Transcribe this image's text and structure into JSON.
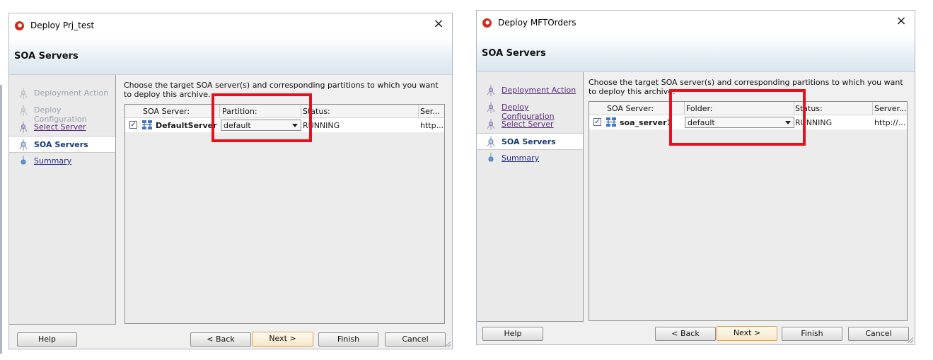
{
  "dialogs": [
    {
      "title": "Deploy Prj_test",
      "header": "SOA Servers",
      "nav": [
        {
          "label": "Deployment Action",
          "state": "disabled"
        },
        {
          "label": "Deploy Configuration",
          "state": "disabled"
        },
        {
          "label": "Select Server",
          "state": "link"
        },
        {
          "label": "SOA Servers",
          "state": "current"
        },
        {
          "label": "Summary",
          "state": "link"
        }
      ],
      "instructions": "Choose the target SOA server(s) and corresponding partitions to which you want to deploy this archive.",
      "columns": [
        "SOA Server:",
        "Partition:",
        "Status:",
        "Ser..."
      ],
      "row": {
        "checked": true,
        "server": "DefaultServer",
        "partition": "default",
        "status": "RUNNING",
        "server_url": "http..."
      },
      "buttons": {
        "help": "Help",
        "back": "< Back",
        "next": "Next >",
        "finish": "Finish",
        "cancel": "Cancel"
      }
    },
    {
      "title": "Deploy MFTOrders",
      "header": "SOA Servers",
      "nav": [
        {
          "label": "Deployment Action",
          "state": "link"
        },
        {
          "label": "Deploy Configuration",
          "state": "link"
        },
        {
          "label": "Select Server",
          "state": "link"
        },
        {
          "label": "SOA Servers",
          "state": "current"
        },
        {
          "label": "Summary",
          "state": "link"
        }
      ],
      "instructions": "Choose the target SOA server(s) and corresponding partitions to which you want to deploy this archive.",
      "columns": [
        "SOA Server:",
        "Folder:",
        "Status:",
        "Server..."
      ],
      "row": {
        "checked": true,
        "server": "soa_server1",
        "partition": "default",
        "status": "RUNNING",
        "server_url": "http://..."
      },
      "buttons": {
        "help": "Help",
        "back": "< Back",
        "next": "Next >",
        "finish": "Finish",
        "cancel": "Cancel"
      }
    }
  ],
  "icons": {
    "close": "close-icon",
    "app": "oracle-app-icon",
    "server": "server-icon",
    "step": "wizard-step-icon"
  },
  "colors": {
    "highlight": "#e3121f",
    "current_step": "#16377a",
    "link": "#2a2f8a"
  }
}
